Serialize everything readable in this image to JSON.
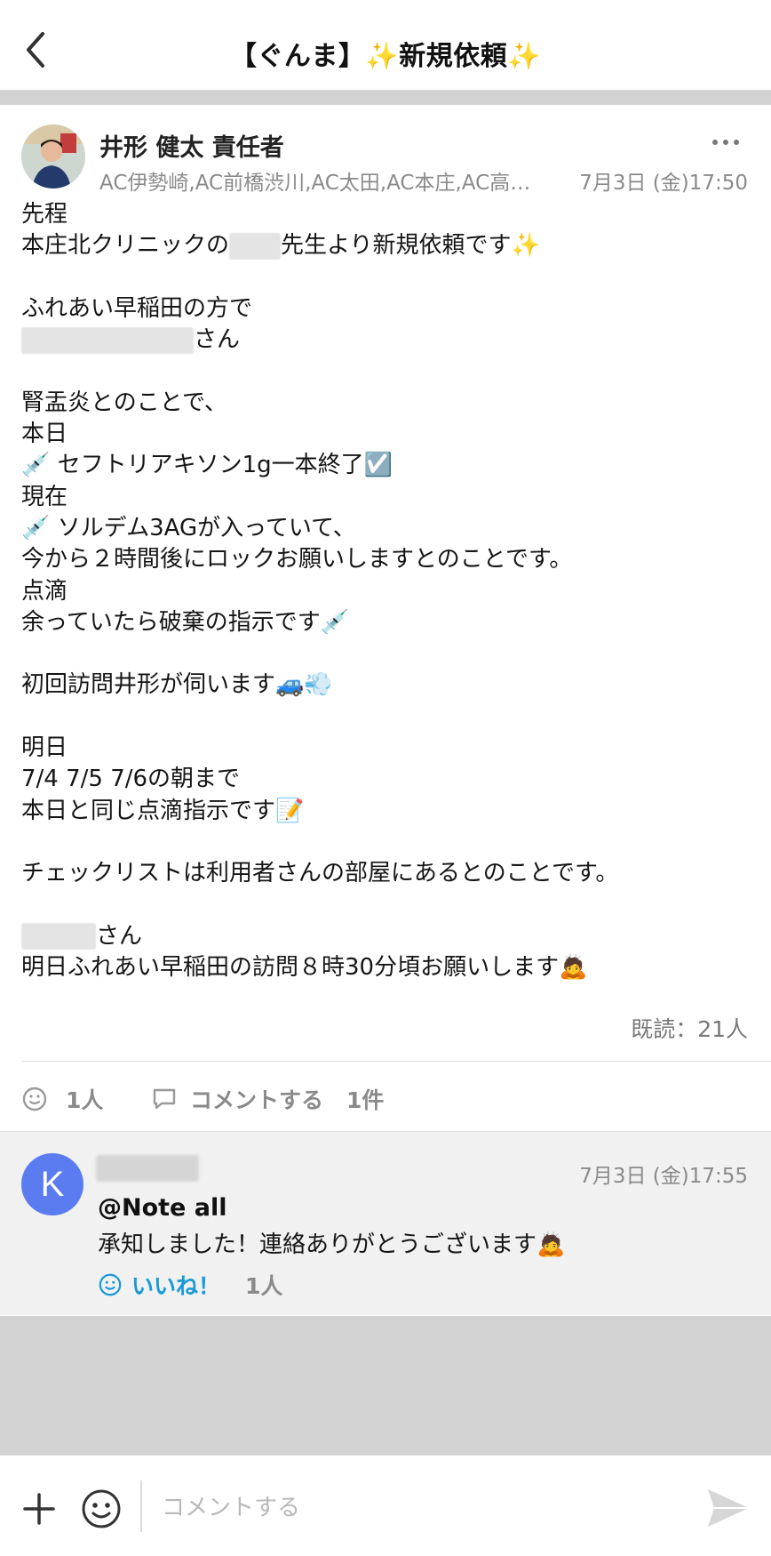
{
  "header": {
    "title_prefix": "【ぐんま】",
    "title_main": "新規依頼",
    "spark": "✨"
  },
  "post": {
    "author": "井形 健太 責任者",
    "groups": "AC伊勢崎,AC前橋渋川,AC太田,AC本庄,AC高…",
    "time": "7月3日 (金)17:50",
    "lines": [
      "先程",
      "本庄北クリニックの",
      "先生より新規依頼です",
      "ふれあい早稲田の方で",
      "さん",
      "腎盂炎とのことで、",
      "本日",
      "セフトリアキソン1g一本終了",
      "現在",
      "ソルデム3AGが入っていて、",
      "今から２時間後にロックお願いしますとのことです。",
      "点滴",
      "余っていたら破棄の指示です",
      "初回訪問井形が伺います",
      "明日",
      "7/4 7/5 7/6の朝まで",
      "本日と同じ点滴指示です",
      "チェックリストは利用者さんの部屋にあるとのことです。",
      "さん",
      "明日ふれあい早稲田の訪問８時30分頃お願いします"
    ],
    "emoji": {
      "syringe": "💉",
      "check": "☑️",
      "car": "🚙",
      "dash": "💨",
      "memo": "📝",
      "bow": "🙇"
    },
    "read_count": "既読：21人",
    "reaction_count": "1人",
    "comment_label": "コメントする",
    "comment_count": "1件"
  },
  "comment": {
    "avatar_letter": "K",
    "time": "7月3日 (金)17:55",
    "mention": "@Note all",
    "text": "承知しました！連絡ありがとうございます",
    "like_label": "いいね！",
    "like_count": "1人"
  },
  "input": {
    "placeholder": "コメントする"
  },
  "colors": {
    "accent_blue": "#1a9ad6",
    "avatar_k": "#5a7cf0",
    "muted": "#8a8a8a"
  }
}
